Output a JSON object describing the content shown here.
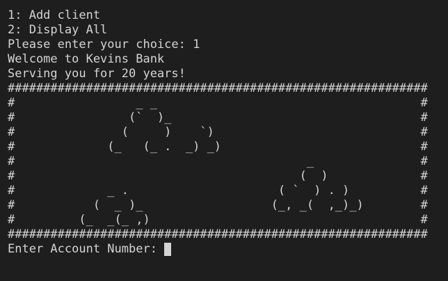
{
  "menu": {
    "option_1": "1: Add client",
    "option_2": "2: Display All",
    "choice_prompt": "Please enter your choice: 1"
  },
  "banner": {
    "welcome": "Welcome to Kevins Bank",
    "tagline": "Serving you for 20 years!"
  },
  "art": {
    "border": "###########################################################",
    "lines": [
      "#                 _ _                                     #",
      "#                (`  )_                                   #",
      "#               (     )    `)                             #",
      "#             (_   (_ .  _) _)                            #",
      "#                                         _               #",
      "#                                        (  )             #",
      "#             _ .                     ( `  ) . )          #",
      "#           (  _ )_                  (_, _(  ,_)_)        #",
      "#         (_  _(_ ,)                                      #"
    ]
  },
  "input": {
    "label": "Enter Account Number: "
  },
  "colors": {
    "background": "#1e1e1e",
    "foreground": "#d4d4d4"
  },
  "icons": {
    "cursor": "block-cursor"
  }
}
